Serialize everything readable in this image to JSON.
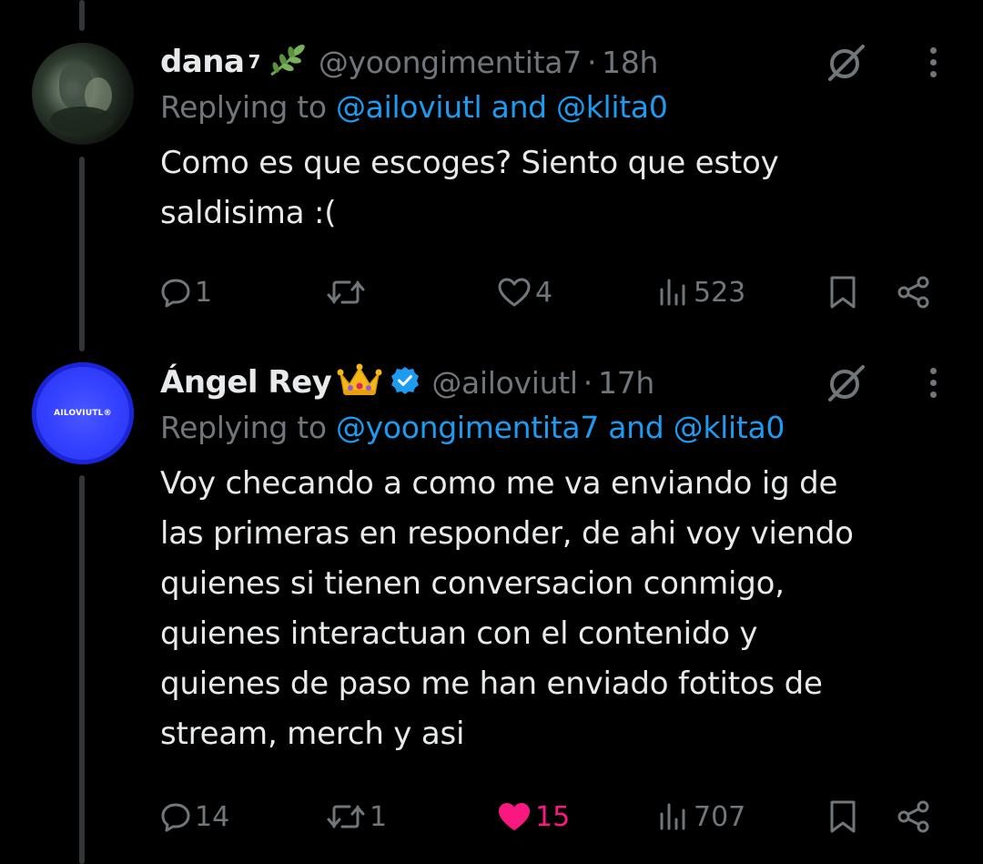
{
  "tweets": [
    {
      "name": "dana",
      "name_sup": "7",
      "name_emoji": "🌿",
      "handle": "@yoongimentita7",
      "time": "18h",
      "replying_prefix": "Replying to",
      "replying_user1": "@ailoviutl",
      "replying_and": "and",
      "replying_user2": "@klita0",
      "text_line1": "Como es que escoges? Siento que estoy",
      "text_line2": "saldisima :(",
      "replies": "1",
      "reposts": "",
      "likes": "4",
      "views": "523",
      "liked": false
    },
    {
      "name": "Ángel Rey",
      "name_emoji": "👑",
      "verified": true,
      "handle": "@ailoviutl",
      "time": "17h",
      "avatar_text": "AILOVIUTL®",
      "replying_prefix": "Replying to",
      "replying_user1": "@yoongimentita7",
      "replying_and": "and",
      "replying_user2": "@klita0",
      "text_line1": "Voy checando a como me va enviando ig de",
      "text_line2": "las primeras en responder, de ahi voy viendo",
      "text_line3": "quienes si tienen conversacion conmigo,",
      "text_line4": "quienes interactuan con el contenido y",
      "text_line5": "quienes de paso me han enviado fotitos de",
      "text_line6": "stream, merch y asi",
      "replies": "14",
      "reposts": "1",
      "likes": "15",
      "views": "707",
      "liked": true
    }
  ],
  "colors": {
    "background": "#000000",
    "text": "#e7e9ea",
    "secondary": "#71767b",
    "link": "#1d9bf0",
    "like": "#f91880",
    "verified": "#1d9bf0"
  },
  "icons": [
    "reply-icon",
    "repost-icon",
    "like-icon",
    "views-icon",
    "bookmark-icon",
    "share-icon",
    "grok-icon",
    "more-icon",
    "verified-badge-icon"
  ]
}
